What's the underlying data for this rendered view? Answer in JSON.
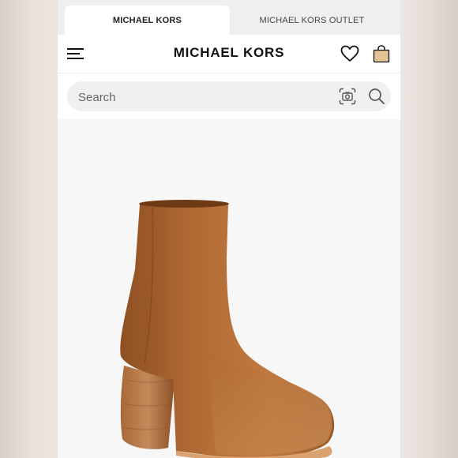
{
  "tabs": {
    "primary": "MICHAEL KORS",
    "outlet": "MICHAEL KORS OUTLET"
  },
  "header": {
    "brand": "MICHAEL KORS",
    "icons": [
      "menu-icon",
      "heart-icon",
      "shopping-bag-icon"
    ]
  },
  "search": {
    "placeholder": "Search",
    "icons": [
      "camera-icon",
      "search-icon"
    ]
  },
  "product": {
    "image": "brown leather ankle boot with block heel"
  },
  "colors": {
    "accent_bag": "#e3c394",
    "leather": "#b06a34",
    "heel": "#9e5f2e"
  }
}
